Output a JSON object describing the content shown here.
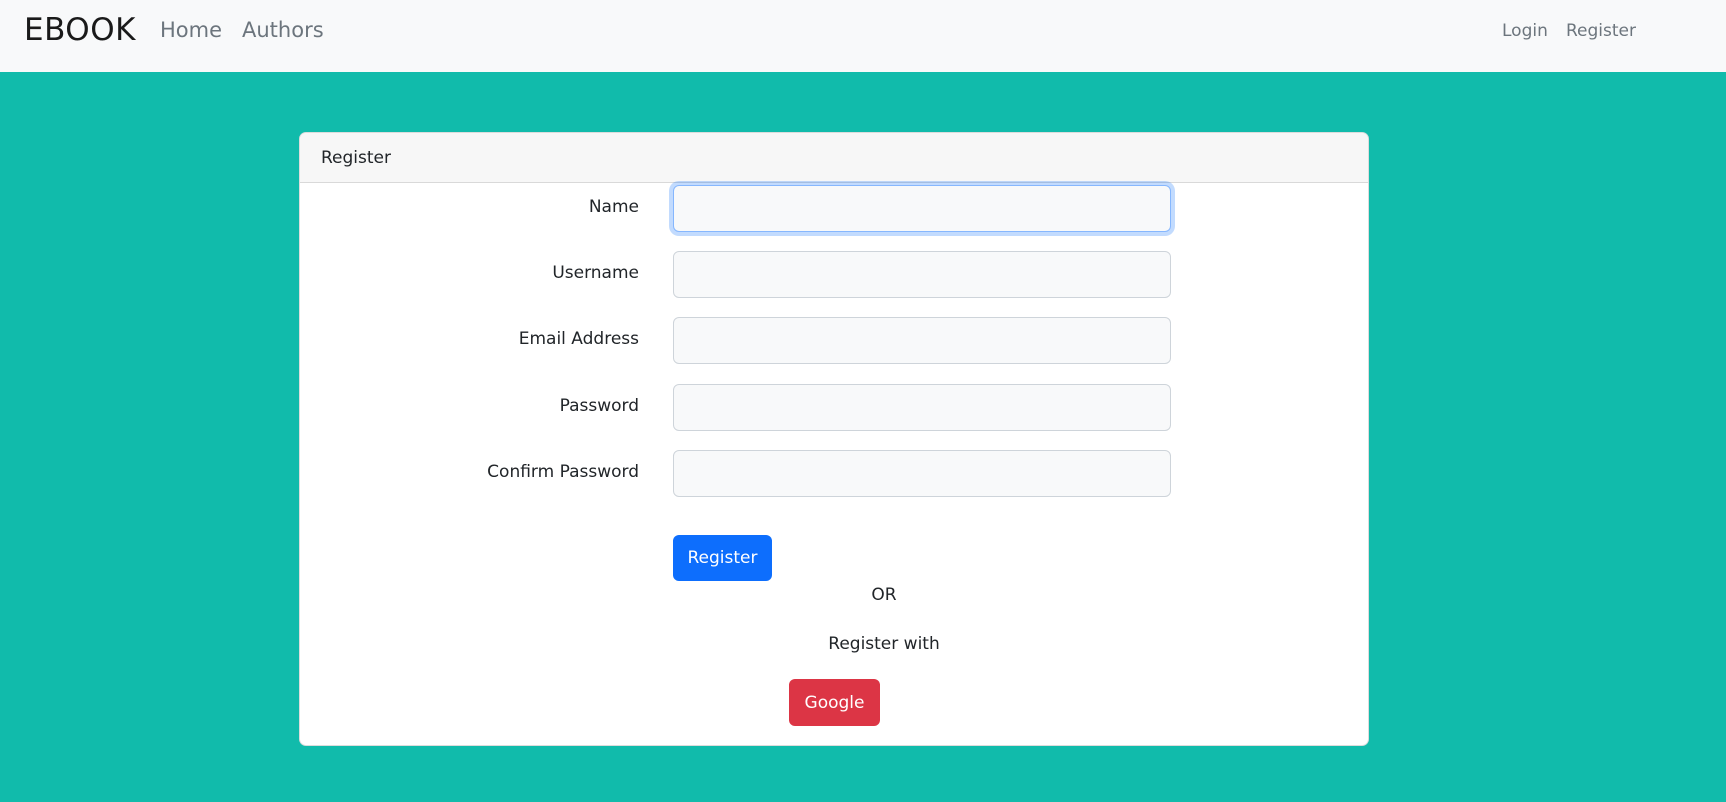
{
  "navbar": {
    "brand": "EBOOK",
    "links": [
      "Home",
      "Authors"
    ],
    "right_links": [
      "Login",
      "Register"
    ]
  },
  "card": {
    "title": "Register"
  },
  "form": {
    "fields": [
      {
        "label": "Name",
        "value": "",
        "placeholder": ""
      },
      {
        "label": "Username",
        "value": "",
        "placeholder": ""
      },
      {
        "label": "Email Address",
        "value": "",
        "placeholder": ""
      },
      {
        "label": "Password",
        "value": "",
        "placeholder": ""
      },
      {
        "label": "Confirm Password",
        "value": "",
        "placeholder": ""
      }
    ],
    "submit_label": "Register",
    "or_text": "OR",
    "register_with_text": "Register with",
    "google_label": "Google"
  },
  "colors": {
    "background": "#11bbab",
    "primary": "#0d6efd",
    "danger": "#dc3545"
  }
}
